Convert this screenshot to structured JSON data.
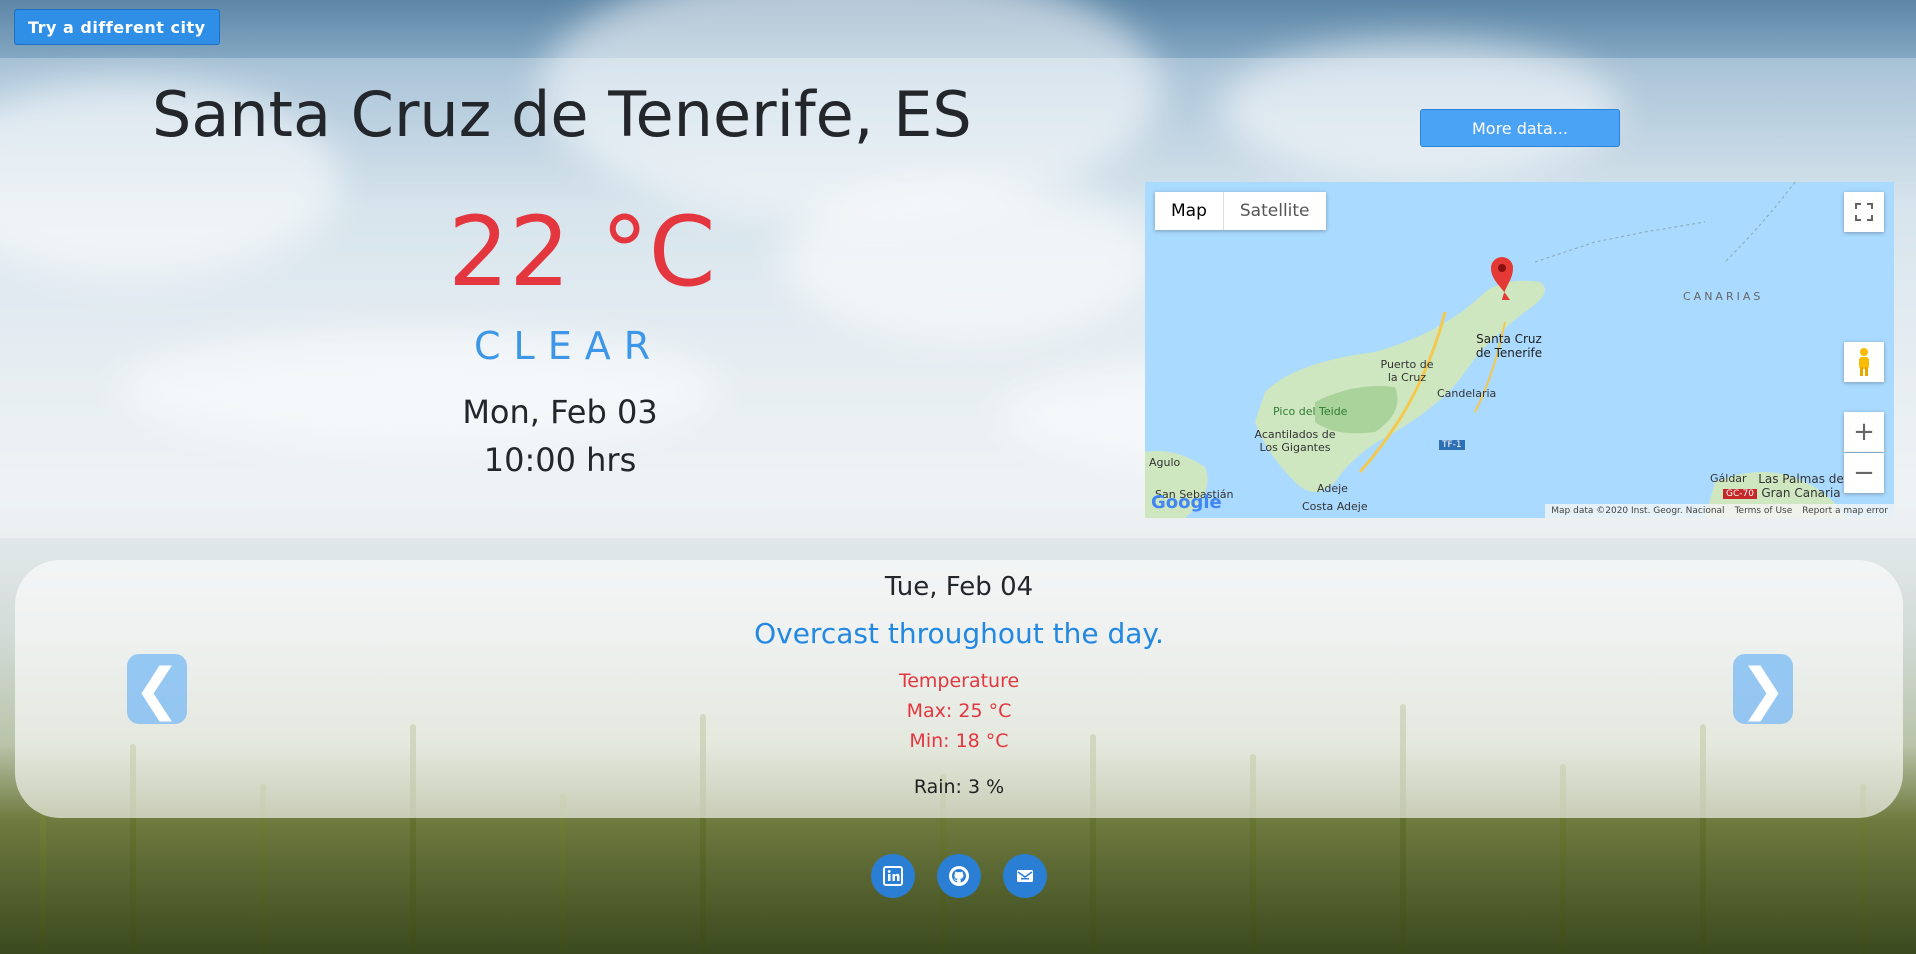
{
  "header": {
    "try_button": "Try a different city"
  },
  "current": {
    "city": "Santa Cruz de Tenerife, ES",
    "temperature": "22 °C",
    "condition": "CLEAR",
    "date": "Mon, Feb 03",
    "time": "10:00 hrs",
    "more_button": "More data..."
  },
  "map": {
    "type_map": "Map",
    "type_satellite": "Satellite",
    "labels": {
      "canarias": "CANARIAS",
      "santa_cruz": "Santa Cruz de Tenerife",
      "puerto": "Puerto de la Cruz",
      "candelaria": "Candelaria",
      "teide": "Pico del Teide",
      "acantilados": "Acantilados de Los Gigantes",
      "agulo": "Agulo",
      "san_sebastian": "San Sebastián",
      "adeje": "Adeje",
      "costa_adeje": "Costa Adeje",
      "galdar": "Gáldar",
      "las_palmas": "Las Palmas de Gran Canaria",
      "tf1": "TF-1",
      "gc70": "GC-70",
      "google": "Google"
    },
    "footer": {
      "data": "Map data ©2020 Inst. Geogr. Nacional",
      "terms": "Terms of Use",
      "report": "Report a map error"
    },
    "zoom_in": "+",
    "zoom_out": "−"
  },
  "forecast": {
    "date": "Tue, Feb 04",
    "summary": "Overcast throughout the day.",
    "temp_heading": "Temperature",
    "max": "Max: 25 °C",
    "min": "Min: 18 °C",
    "rain": "Rain: 3 %",
    "prev": "❮",
    "next": "❯"
  },
  "colors": {
    "accent": "#2f8fe6",
    "temperature": "#e4363f",
    "summary": "#2388e2"
  },
  "social": [
    "linkedin-icon",
    "github-icon",
    "mail-icon"
  ]
}
